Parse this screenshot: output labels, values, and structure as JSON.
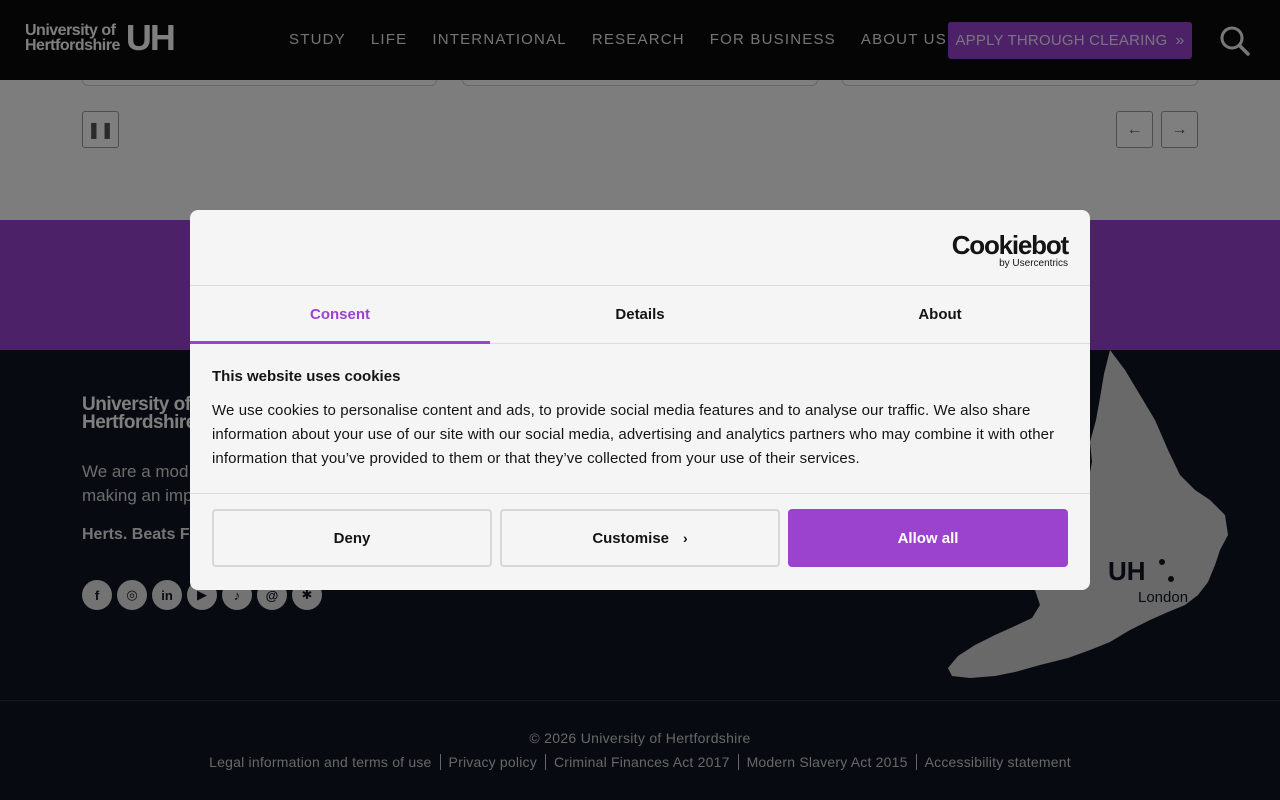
{
  "header": {
    "logo_line1": "University of",
    "logo_line2": "Hertfordshire",
    "logo_mark": "UH",
    "nav": [
      {
        "label": "Study"
      },
      {
        "label": "Life"
      },
      {
        "label": "International"
      },
      {
        "label": "Research"
      },
      {
        "label": "For Business"
      },
      {
        "label": "About us"
      }
    ],
    "clearing_button": "APPLY THROUGH CLEARING",
    "search_icon": "search-icon"
  },
  "carousel": {
    "pause_icon": "pause-icon",
    "prev_icon": "arrow-left-icon",
    "next_icon": "arrow-right-icon"
  },
  "footer": {
    "logo_line1": "University of",
    "logo_line2": "Hertfordshire",
    "about_text": "We are a mod… making an imp…",
    "about_line1": "We are a mod",
    "about_line2": "making an imp",
    "strapline": "Herts. Beats F",
    "socials": [
      {
        "icon": "facebook-icon",
        "glyph": "f"
      },
      {
        "icon": "instagram-icon",
        "glyph": "◎"
      },
      {
        "icon": "linkedin-icon",
        "glyph": "in"
      },
      {
        "icon": "youtube-icon",
        "glyph": "▶"
      },
      {
        "icon": "tiktok-icon",
        "glyph": "♪"
      },
      {
        "icon": "threads-icon",
        "glyph": "@"
      },
      {
        "icon": "bluesky-icon",
        "glyph": "✱"
      }
    ],
    "map_label_mark": "UH",
    "map_label_city": "London",
    "copyright": "© 2026 University of Hertfordshire",
    "legal_links": [
      "Legal information and terms of use",
      "Privacy policy",
      "Criminal Finances Act 2017",
      "Modern Slavery Act 2015",
      "Accessibility statement"
    ]
  },
  "cookie_dialog": {
    "brand": "Cookiebot",
    "brand_sub": "by Usercentrics",
    "tabs": [
      {
        "label": "Consent",
        "active": true
      },
      {
        "label": "Details",
        "active": false
      },
      {
        "label": "About",
        "active": false
      }
    ],
    "title": "This website uses cookies",
    "body": "We use cookies to personalise content and ads, to provide social media features and to analyse our traffic. We also share information about your use of our site with our social media, advertising and analytics partners who may combine it with other information that you’ve provided to them or that they’ve collected from your use of their services.",
    "buttons": {
      "deny": "Deny",
      "customise": "Customise",
      "allow_all": "Allow all"
    }
  },
  "colors": {
    "accent": "#9b43cf",
    "header_bg": "#0a0a0a",
    "footer_bg": "#111422",
    "dialog_bg": "#f5f5f5"
  }
}
